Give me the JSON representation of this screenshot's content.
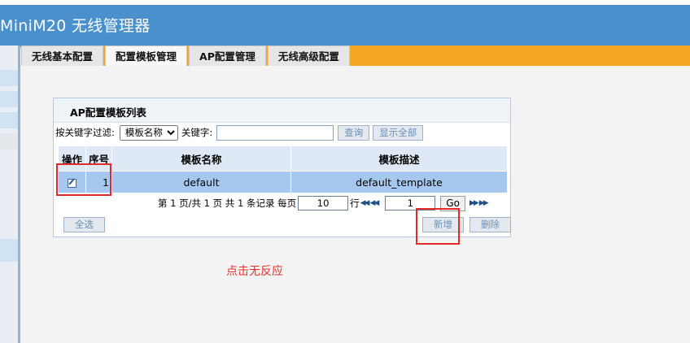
{
  "app": {
    "title": "MiniM20 无线管理器"
  },
  "tabs": [
    {
      "label": "无线基本配置",
      "active": false
    },
    {
      "label": "配置模板管理",
      "active": true
    },
    {
      "label": "AP配置管理",
      "active": false
    },
    {
      "label": "无线高级配置",
      "active": false
    }
  ],
  "panel": {
    "title": "AP配置模板列表",
    "filter": {
      "label": "按关键字过滤:",
      "select_value": "模板名称",
      "keyword_label": "关键字:",
      "keyword_value": "",
      "search_button": "查询",
      "show_all_button": "显示全部"
    },
    "table": {
      "headers": [
        "操作",
        "序号",
        "模板名称",
        "模板描述"
      ],
      "rows": [
        {
          "no": "1",
          "name": "default",
          "desc": "default_template",
          "selected": true
        }
      ]
    },
    "pager": {
      "prefix": "第",
      "page": "1",
      "mid1": "页/共",
      "total_pages": "1",
      "mid2": "页 共",
      "total_records": "1",
      "mid3": "条记录 每页",
      "per_page": "10",
      "row_unit": "行",
      "goto_page": "1",
      "go_button": "Go"
    },
    "buttons": {
      "select_all": "全选",
      "add": "新增",
      "delete": "删除"
    }
  },
  "annotation": {
    "note": "点击无反应"
  },
  "colors": {
    "header": "#4a90cd",
    "tabbar": "#f5a623",
    "highlight": "#e22a2a",
    "selected_row": "#a6c8ef"
  }
}
